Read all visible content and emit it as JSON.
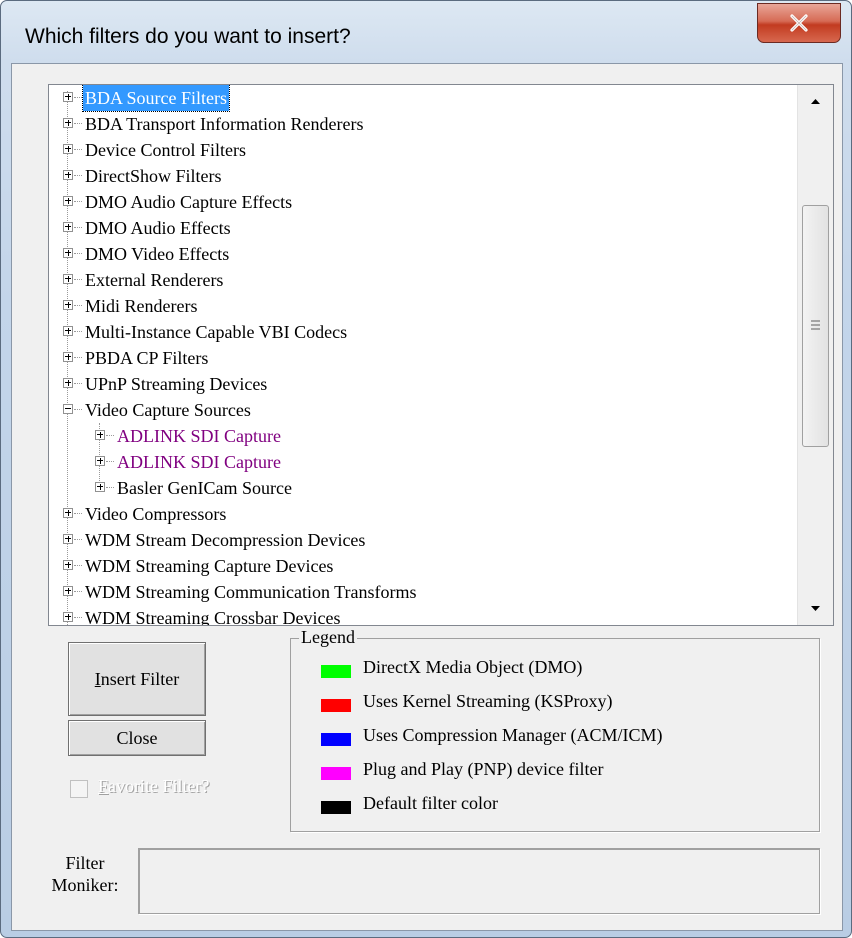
{
  "window": {
    "title": "Which filters do you want to insert?",
    "close_glyph": "x"
  },
  "tree": {
    "items": [
      {
        "label": "BDA Source Filters",
        "level": 0,
        "expanded": false,
        "selected": true,
        "color": "#000000"
      },
      {
        "label": "BDA Transport Information Renderers",
        "level": 0,
        "expanded": false,
        "selected": false,
        "color": "#000000"
      },
      {
        "label": "Device Control Filters",
        "level": 0,
        "expanded": false,
        "selected": false,
        "color": "#000000"
      },
      {
        "label": "DirectShow Filters",
        "level": 0,
        "expanded": false,
        "selected": false,
        "color": "#000000"
      },
      {
        "label": "DMO Audio Capture Effects",
        "level": 0,
        "expanded": false,
        "selected": false,
        "color": "#000000"
      },
      {
        "label": "DMO Audio Effects",
        "level": 0,
        "expanded": false,
        "selected": false,
        "color": "#000000"
      },
      {
        "label": "DMO Video Effects",
        "level": 0,
        "expanded": false,
        "selected": false,
        "color": "#000000"
      },
      {
        "label": "External Renderers",
        "level": 0,
        "expanded": false,
        "selected": false,
        "color": "#000000"
      },
      {
        "label": "Midi Renderers",
        "level": 0,
        "expanded": false,
        "selected": false,
        "color": "#000000"
      },
      {
        "label": "Multi-Instance Capable VBI Codecs",
        "level": 0,
        "expanded": false,
        "selected": false,
        "color": "#000000"
      },
      {
        "label": "PBDA CP Filters",
        "level": 0,
        "expanded": false,
        "selected": false,
        "color": "#000000"
      },
      {
        "label": "UPnP Streaming Devices",
        "level": 0,
        "expanded": false,
        "selected": false,
        "color": "#000000"
      },
      {
        "label": "Video Capture Sources",
        "level": 0,
        "expanded": true,
        "selected": false,
        "color": "#000000"
      },
      {
        "label": "ADLINK SDI Capture",
        "level": 1,
        "expanded": false,
        "selected": false,
        "color": "#800080"
      },
      {
        "label": "ADLINK SDI Capture",
        "level": 1,
        "expanded": false,
        "selected": false,
        "color": "#800080"
      },
      {
        "label": "Basler GenICam Source",
        "level": 1,
        "expanded": false,
        "selected": false,
        "color": "#000000"
      },
      {
        "label": "Video Compressors",
        "level": 0,
        "expanded": false,
        "selected": false,
        "color": "#000000"
      },
      {
        "label": "WDM Stream Decompression Devices",
        "level": 0,
        "expanded": false,
        "selected": false,
        "color": "#000000"
      },
      {
        "label": "WDM Streaming Capture Devices",
        "level": 0,
        "expanded": false,
        "selected": false,
        "color": "#000000"
      },
      {
        "label": "WDM Streaming Communication Transforms",
        "level": 0,
        "expanded": false,
        "selected": false,
        "color": "#000000"
      },
      {
        "label": "WDM Streaming Crossbar Devices",
        "level": 0,
        "expanded": false,
        "selected": false,
        "color": "#000000"
      }
    ],
    "scroll_position": 0.25
  },
  "buttons": {
    "insert_label": "Insert Filter",
    "insert_mnemonic": "I",
    "close_label": "Close"
  },
  "favorite": {
    "label": "Favorite Filter?",
    "mnemonic": "F",
    "checked": false,
    "enabled": false
  },
  "legend": {
    "title": "Legend",
    "items": [
      {
        "label": "DirectX Media Object (DMO)",
        "color": "#00ff00"
      },
      {
        "label": "Uses Kernel Streaming (KSProxy)",
        "color": "#ff0000"
      },
      {
        "label": "Uses Compression Manager (ACM/ICM)",
        "color": "#0000ff"
      },
      {
        "label": "Plug and Play (PNP) device filter",
        "color": "#ff00ff"
      },
      {
        "label": "Default filter color",
        "color": "#000000"
      }
    ]
  },
  "moniker": {
    "label_line1": "Filter",
    "label_line2": "Moniker:",
    "value": ""
  }
}
